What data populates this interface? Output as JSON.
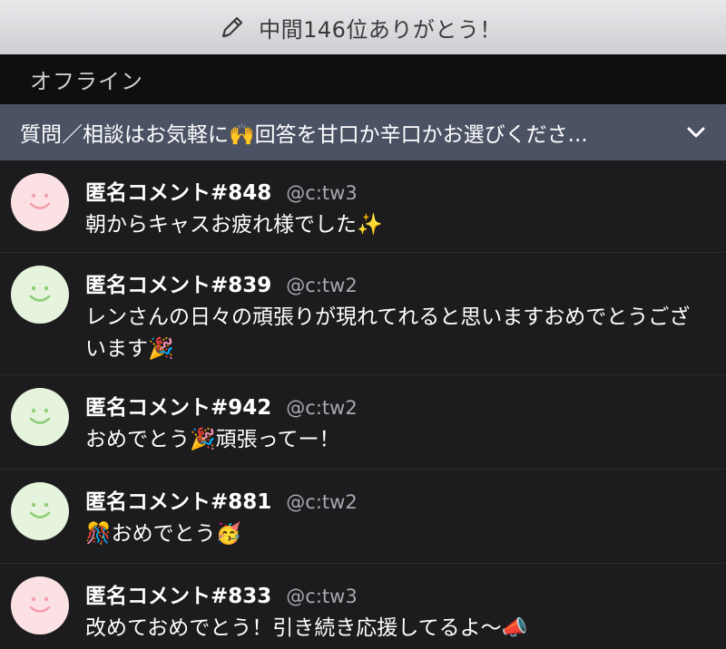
{
  "banner": {
    "status_text": "中間146位ありがとう！",
    "icon": "pencil-icon"
  },
  "offline": {
    "label": "オフライン"
  },
  "notice": {
    "text": "質問／相談はお気軽に🙌回答を甘口か辛口かお選びくださ...",
    "icon": "chevron-down-icon"
  },
  "comments": [
    {
      "name": "匿名コメント#848",
      "handle": "@c:tw3",
      "text": "朝からキャスお疲れ様でした✨",
      "avatar_color": "#fbe1e4"
    },
    {
      "name": "匿名コメント#839",
      "handle": "@c:tw2",
      "text": "レンさんの日々の頑張りが現れてれると思いますおめでとうございます🎉",
      "avatar_color": "#e6f4de"
    },
    {
      "name": "匿名コメント#942",
      "handle": "@c:tw2",
      "text": "おめでとう🎉頑張ってー！",
      "avatar_color": "#e6f4de"
    },
    {
      "name": "匿名コメント#881",
      "handle": "@c:tw2",
      "text": "🎊おめでとう🥳",
      "avatar_color": "#e6f4de"
    },
    {
      "name": "匿名コメント#833",
      "handle": "@c:tw3",
      "text": "改めておめでとう！引き続き応援してるよ〜📣",
      "avatar_color": "#fbe1e4"
    }
  ],
  "colors": {
    "background": "#1c1c1e",
    "notice_bar": "#4a5264",
    "offline_bar": "#0f0f10",
    "smile_pink": "#f3a1ad",
    "smile_green": "#8fcf78"
  }
}
